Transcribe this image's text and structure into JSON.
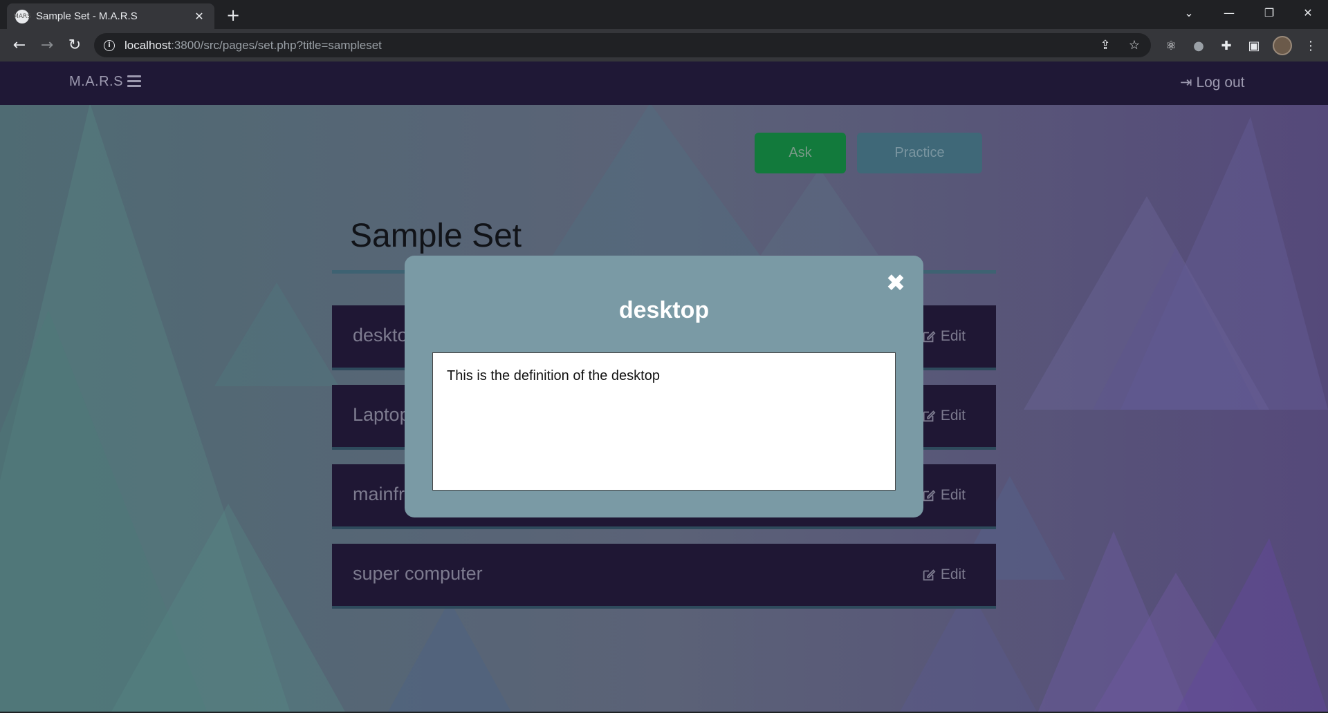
{
  "browser": {
    "tab_title": "Sample Set - M.A.R.S",
    "favicon_text": "MARS",
    "new_tab_icon": "plus-icon",
    "url_host": "localhost",
    "url_rest": ":3800/src/pages/set.php?title=sampleset"
  },
  "navbar": {
    "brand": "M.A.R.S",
    "logout_label": "Log out"
  },
  "actions": {
    "ask_label": "Ask",
    "practice_label": "Practice"
  },
  "set": {
    "title": "Sample Set",
    "terms": [
      {
        "term": "desktop",
        "edit_label": "Edit"
      },
      {
        "term": "Laptop",
        "edit_label": "Edit"
      },
      {
        "term": "mainframe",
        "edit_label": "Edit"
      },
      {
        "term": "super computer",
        "edit_label": "Edit"
      }
    ]
  },
  "modal": {
    "title": "desktop",
    "definition": "This is the definition of the desktop",
    "close_glyph": "✖"
  },
  "colors": {
    "navbar_bg": "#1f1836",
    "row_bg": "#1f1734",
    "ask_bg": "#127a3c",
    "practice_bg": "#3f6878",
    "modal_bg": "#7a9aa5"
  }
}
